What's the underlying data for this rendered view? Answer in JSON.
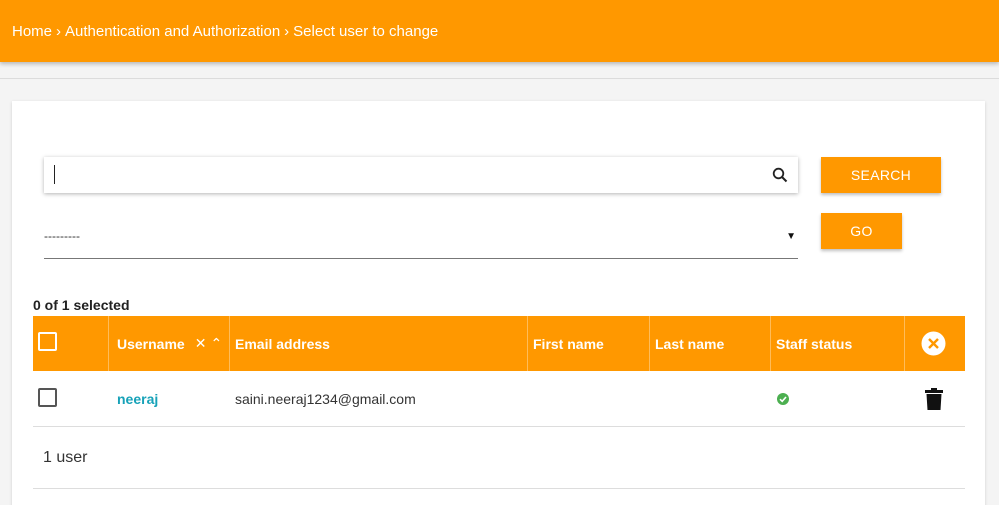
{
  "breadcrumb": {
    "items": [
      "Home",
      "Authentication and Authorization",
      "Select user to change"
    ],
    "separator": "›"
  },
  "search": {
    "value": "",
    "placeholder": "",
    "button_label": "SEARCH"
  },
  "actions": {
    "selected_value": "---------",
    "go_label": "GO"
  },
  "selection": {
    "counter": "0 of 1 selected"
  },
  "table": {
    "columns": [
      "Username",
      "Email address",
      "First name",
      "Last name",
      "Staff status"
    ],
    "sort_remove_glyph": "✕",
    "sort_asc_glyph": "⌃",
    "rows": [
      {
        "username": "neeraj",
        "email": "saini.neeraj1234@gmail.com",
        "first_name": "",
        "last_name": "",
        "staff_status": "true"
      }
    ]
  },
  "result_count": "1 user",
  "colors": {
    "accent": "#ff9800",
    "link": "#17a2b8",
    "success": "#4caf50"
  },
  "icons": {
    "search": "search-icon",
    "clear": "close-circle-icon",
    "delete": "trash-icon",
    "staff": "check-circle-icon"
  }
}
